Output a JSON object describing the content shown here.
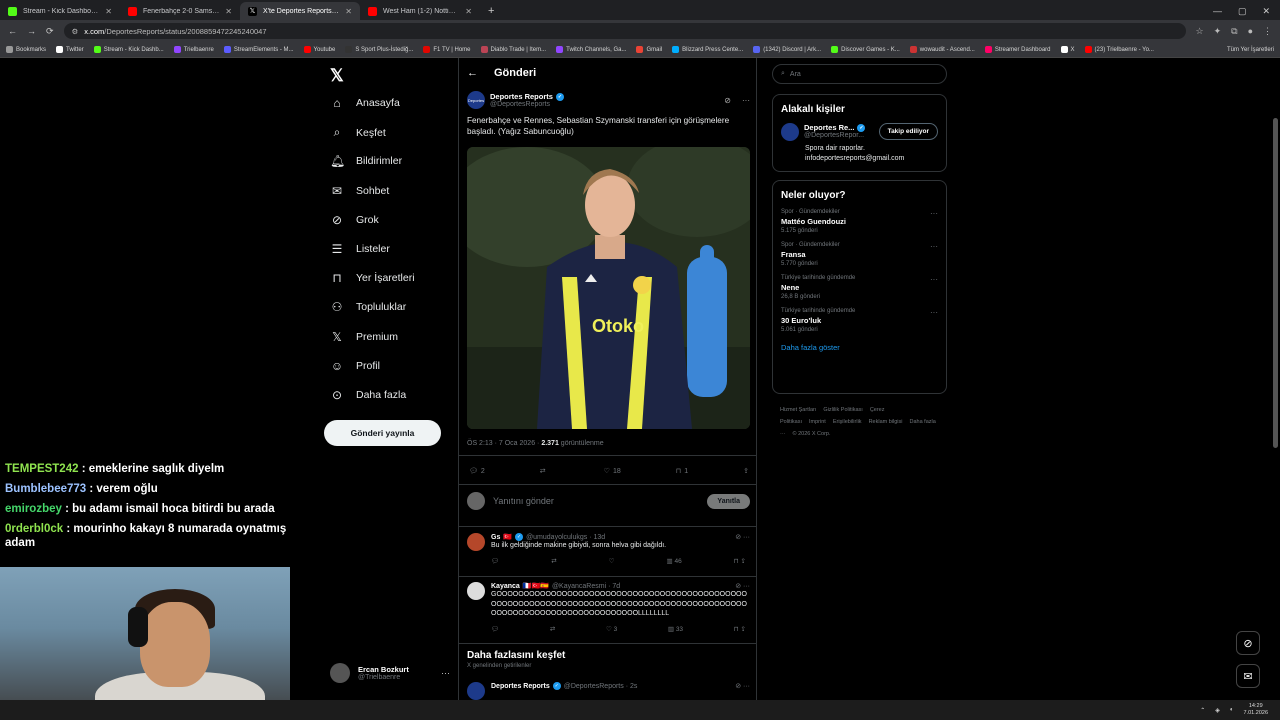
{
  "browser": {
    "tabs": [
      {
        "title": "Stream - Kick Dashboard",
        "color": "#53fc18",
        "active": false
      },
      {
        "title": "Fenerbahçe 2-0 Samsunspor | Ö",
        "color": "#ff0000",
        "active": false
      },
      {
        "title": "X'te Deportes Reports: \"Fenerb",
        "color": "#ffffff",
        "active": true
      },
      {
        "title": "West Ham (1-2) Nottingham F",
        "color": "#ff0000",
        "active": false
      }
    ],
    "url_host": "x.com",
    "url_path": "/DeportesReports/status/2008859472245240047",
    "bookmarks": [
      "Bookmarks",
      "Twitter",
      "Stream - Kick Dashb...",
      "Trielbaenre",
      "StreamElements - M...",
      "Youtube",
      "S Sport Plus-İstediğ...",
      "F1 TV | Home",
      "Diablo Trade | Item...",
      "Twitch Channels, Ga...",
      "Gmail",
      "Blizzard Press Cente...",
      "(1342) Discord | Ark...",
      "Discover Games - K...",
      "wowaudit - Ascend...",
      "Streamer Dashboard",
      "X",
      "(23) Trielbaenre - Yo..."
    ],
    "bookmarks_right": "Tüm Yer İşaretleri"
  },
  "nav": {
    "items": [
      "Anasayfa",
      "Keşfet",
      "Bildirimler",
      "Sohbet",
      "Grok",
      "Listeler",
      "Yer İşaretleri",
      "Topluluklar",
      "Premium",
      "Profil",
      "Daha fazla"
    ],
    "icons": [
      "home-icon",
      "search-icon",
      "bell-icon",
      "mail-icon",
      "grok-icon",
      "list-icon",
      "bookmark-icon",
      "communities-icon",
      "x-premium-icon",
      "person-icon",
      "more-circle-icon"
    ],
    "post_button": "Gönderi yayınla",
    "account_name": "Ercan Bozkurt",
    "account_handle": "@Trielbaenre"
  },
  "main": {
    "header": "Gönderi",
    "tweet": {
      "avatar_text": "Deportes",
      "name": "Deportes Reports",
      "handle": "@DeportesReports",
      "text": "Fenerbahçe ve Rennes, Sebastian Szymanski transferi için görüşmelere başladı. (Yağız Sabuncuoğlu)",
      "time": "ÖS 2:13 · 7 Oca 2026 · ",
      "views": "2.371",
      "views_label": " görüntülenme",
      "replies": "2",
      "reposts": "",
      "likes": "18",
      "bookmarks": "1"
    },
    "reply_placeholder": "Yanıtını gönder",
    "reply_button": "Yanıtla",
    "comments": [
      {
        "name": "Gs",
        "flags": "🇹🇷",
        "handle": "@umudayolculukgs · 13d",
        "text": "Bu ilk geldiğinde makine gibiydi, sonra helva gibi dağıldı.",
        "replies": "",
        "reposts": "",
        "likes": "",
        "views": "46",
        "color": "#b5472a"
      },
      {
        "name": "Kayanca",
        "flags": "🇫🇷🇹🇷🇪🇸",
        "handle": "@KayancaResmi · 7d",
        "text": "GOOOOOOOOOOOOOOOOOOOOOOOOOOOOOOOOOOOOOOOOOOOOOOOOOOOOOOOOOOOOOOOOOOOOOOOOOOOOOOOOOOOOOOOOOOOOOOOOOOOOOOOOOOOOOOOOOOOOOOOOLLLLLLLL",
        "replies": "",
        "reposts": "",
        "likes": "3",
        "views": "33",
        "color": "#dddddd"
      }
    ],
    "discover_title": "Daha fazlasını keşfet",
    "discover_sub": "X genelinden getirilenler",
    "discover_item": {
      "name": "Deportes Reports",
      "handle": "@DeportesReports · 2s"
    }
  },
  "right": {
    "search_placeholder": "Ara",
    "related_title": "Alakalı kişiler",
    "related": {
      "name": "Deportes Re...",
      "handle": "@DeportesRepor...",
      "button": "Takip ediliyor",
      "bio": "Spora dair raporlar. infodeportesreports@gmail.com"
    },
    "trends_title": "Neler oluyor?",
    "trends": [
      {
        "category": "Spor · Gündemdekiler",
        "name": "Mattéo Guendouzi",
        "posts": "5.175 gönderi"
      },
      {
        "category": "Spor · Gündemdekiler",
        "name": "Fransa",
        "posts": "5.770 gönderi"
      },
      {
        "category": "Türkiye tarihinde gündemde",
        "name": "Nene",
        "posts": "26,8 B gönderi"
      },
      {
        "category": "Türkiye tarihinde gündemde",
        "name": "30 Euro'luk",
        "posts": "5.061 gönderi"
      }
    ],
    "show_more": "Daha fazla göster",
    "footer": [
      "Hizmet Şartları",
      "Gizlilik Politikası",
      "Çerez Politikası",
      "Imprint",
      "Erişilebilirlik",
      "Reklam bilgisi",
      "Daha fazla ···",
      "© 2026 X Corp."
    ]
  },
  "chat": [
    {
      "user": "TEMPEST242",
      "msg": " : emeklerine saglık diyelm",
      "color": "#8fe34f"
    },
    {
      "user": "Bumblebee773",
      "msg": " : verem oğlu",
      "color": "#9cc2ff"
    },
    {
      "user": "emirozbey",
      "msg": " : bu adamı ismail hoca bitirdi bu arada",
      "color": "#45d66a"
    },
    {
      "user": "0rderbl0ck",
      "msg": " : mourinho kakayı 8 numarada oynatmış adam",
      "color": "#8fe34f"
    }
  ],
  "taskbar": {
    "time": "14:29",
    "date": "7.01.2026"
  }
}
